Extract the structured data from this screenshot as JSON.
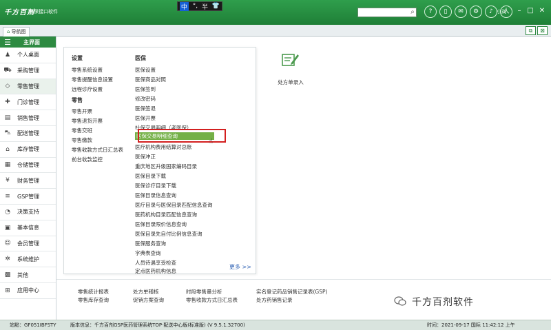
{
  "app": {
    "logo": "千方百剂",
    "name": "医保接口软件",
    "user": "小刘"
  },
  "ime": {
    "mode": "中",
    "punct": "°,",
    "width": "半",
    "shirt": "👕"
  },
  "search": {
    "placeholder": ""
  },
  "top_icons": [
    "?",
    "▯",
    "✉",
    "⚙",
    "♪",
    "人"
  ],
  "tab": {
    "label": "导航图"
  },
  "sidebar": {
    "header": "主界面",
    "items": [
      {
        "label": "个人桌面",
        "icon": "desktop-icon"
      },
      {
        "label": "采购管理",
        "icon": "cart-icon"
      },
      {
        "label": "零售管理",
        "icon": "tag-icon"
      },
      {
        "label": "门诊管理",
        "icon": "clinic-icon"
      },
      {
        "label": "销售管理",
        "icon": "sales-icon"
      },
      {
        "label": "配送管理",
        "icon": "truck-icon"
      },
      {
        "label": "库存管理",
        "icon": "stock-icon"
      },
      {
        "label": "仓储管理",
        "icon": "warehouse-icon"
      },
      {
        "label": "财务管理",
        "icon": "finance-icon"
      },
      {
        "label": "GSP管理",
        "icon": "gsp-icon"
      },
      {
        "label": "决策支持",
        "icon": "chart-icon"
      },
      {
        "label": "基本信息",
        "icon": "info-icon"
      },
      {
        "label": "会员管理",
        "icon": "member-icon"
      },
      {
        "label": "系统维护",
        "icon": "settings-icon"
      },
      {
        "label": "其他",
        "icon": "other-icon"
      },
      {
        "label": "应用中心",
        "icon": "apps-icon"
      }
    ]
  },
  "menu": {
    "settings_title": "设置",
    "settings": [
      "零售系统设置",
      "零售提醒信息设置",
      "远程诊疗设置"
    ],
    "retail_title": "零售",
    "retail": [
      "零售开票",
      "零售退货开票",
      "零售交班",
      "零售缴款",
      "零售收款方式日汇总表",
      "前台收款监控"
    ],
    "yibao_title": "医保",
    "yibao": [
      "医保设置",
      "医保商品对照",
      "医保签到",
      "修改密码",
      "医保签退",
      "医保开票",
      "社保交易明细（老医保）",
      "医保交易明细查询",
      "医疗机构费用结算对总账",
      "医保冲正",
      "重庆地区升级国家编码目录",
      "医保目录下载",
      "医保诊疗目录下载",
      "医保目录信息查询",
      "医疗目录与医保目录匹配信息查询",
      "医药机构目录匹配信息查询",
      "医保目录限价信息查询",
      "医保目录先自付比例信息查询",
      "医保服务查询",
      "字典表查询",
      "人员待遇享受检查",
      "定点医药机构信息"
    ],
    "more": "更多 >>"
  },
  "quick": {
    "label": "处方单录入"
  },
  "bottom_links": [
    "零售统计报表",
    "零售库存查询",
    "处方单稽核",
    "促销方案查询",
    "时段零售量分析",
    "零售收款方式日汇总表",
    "实名登记药品销售记录表(GSP)",
    "处方药销售记录"
  ],
  "watermark": "千方百剂软件",
  "status": {
    "site": "站點：GF051IBFSTY",
    "version": "版本信息：千方百剂GSP医药管理系统TOP·配送中心版(标准版) (V 9.5.1.32700)",
    "time": "时间：2021-09-17 国际 11:42:12 上午"
  },
  "colors": {
    "brand": "#2d8a41",
    "highlight": "#74b046",
    "annotation": "#d31f1f"
  }
}
